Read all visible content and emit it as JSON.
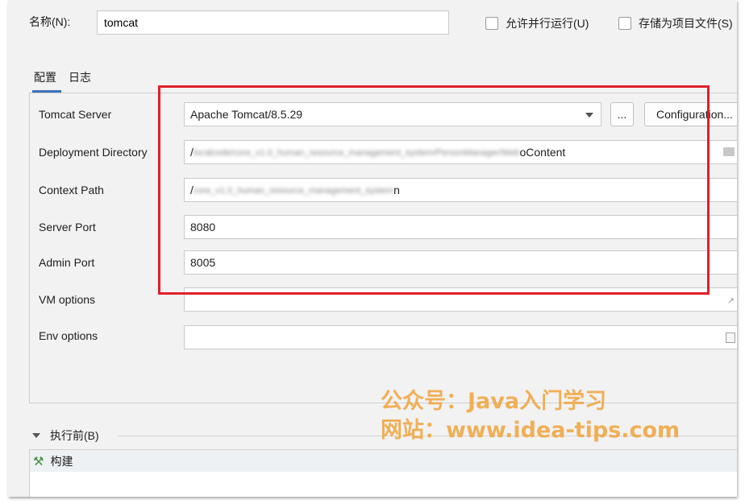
{
  "header": {
    "name_label": "名称(N):",
    "name_value": "tomcat",
    "parallel_run_label": "允许并行运行(U)",
    "store_as_file_label": "存储为项目文件(S)"
  },
  "tabs": [
    {
      "label": "配置",
      "active": true
    },
    {
      "label": "日志",
      "active": false
    }
  ],
  "form": {
    "tomcat_server": {
      "label": "Tomcat Server",
      "value": "Apache Tomcat/8.5.29",
      "more_button": "...",
      "configuration_button": "Configuration..."
    },
    "deployment_directory": {
      "label": "Deployment Directory",
      "value_prefix": "/",
      "value_blurred": "localcode/core_v1.0_human_resource_management_system/PersonManager/Web",
      "value_suffix": "oContent"
    },
    "context_path": {
      "label": "Context Path",
      "value_prefix": "/",
      "value_blurred": "core_v1.0_human_resource_management_system",
      "value_suffix": "n"
    },
    "server_port": {
      "label": "Server Port",
      "value": "8080"
    },
    "admin_port": {
      "label": "Admin Port",
      "value": "8005"
    },
    "vm_options": {
      "label": "VM options",
      "value": ""
    },
    "env_options": {
      "label": "Env options",
      "value": ""
    }
  },
  "before_launch": {
    "label": "执行前(B)",
    "items": [
      {
        "label": "构建",
        "icon": "hammer-icon"
      }
    ]
  },
  "watermark": {
    "line1": "公众号：Java入门学习",
    "line2": "网站：www.idea-tips.com"
  },
  "colors": {
    "highlight_border": "#e0202a",
    "accent": "#3b73b9",
    "watermark": "#f0a43c"
  }
}
